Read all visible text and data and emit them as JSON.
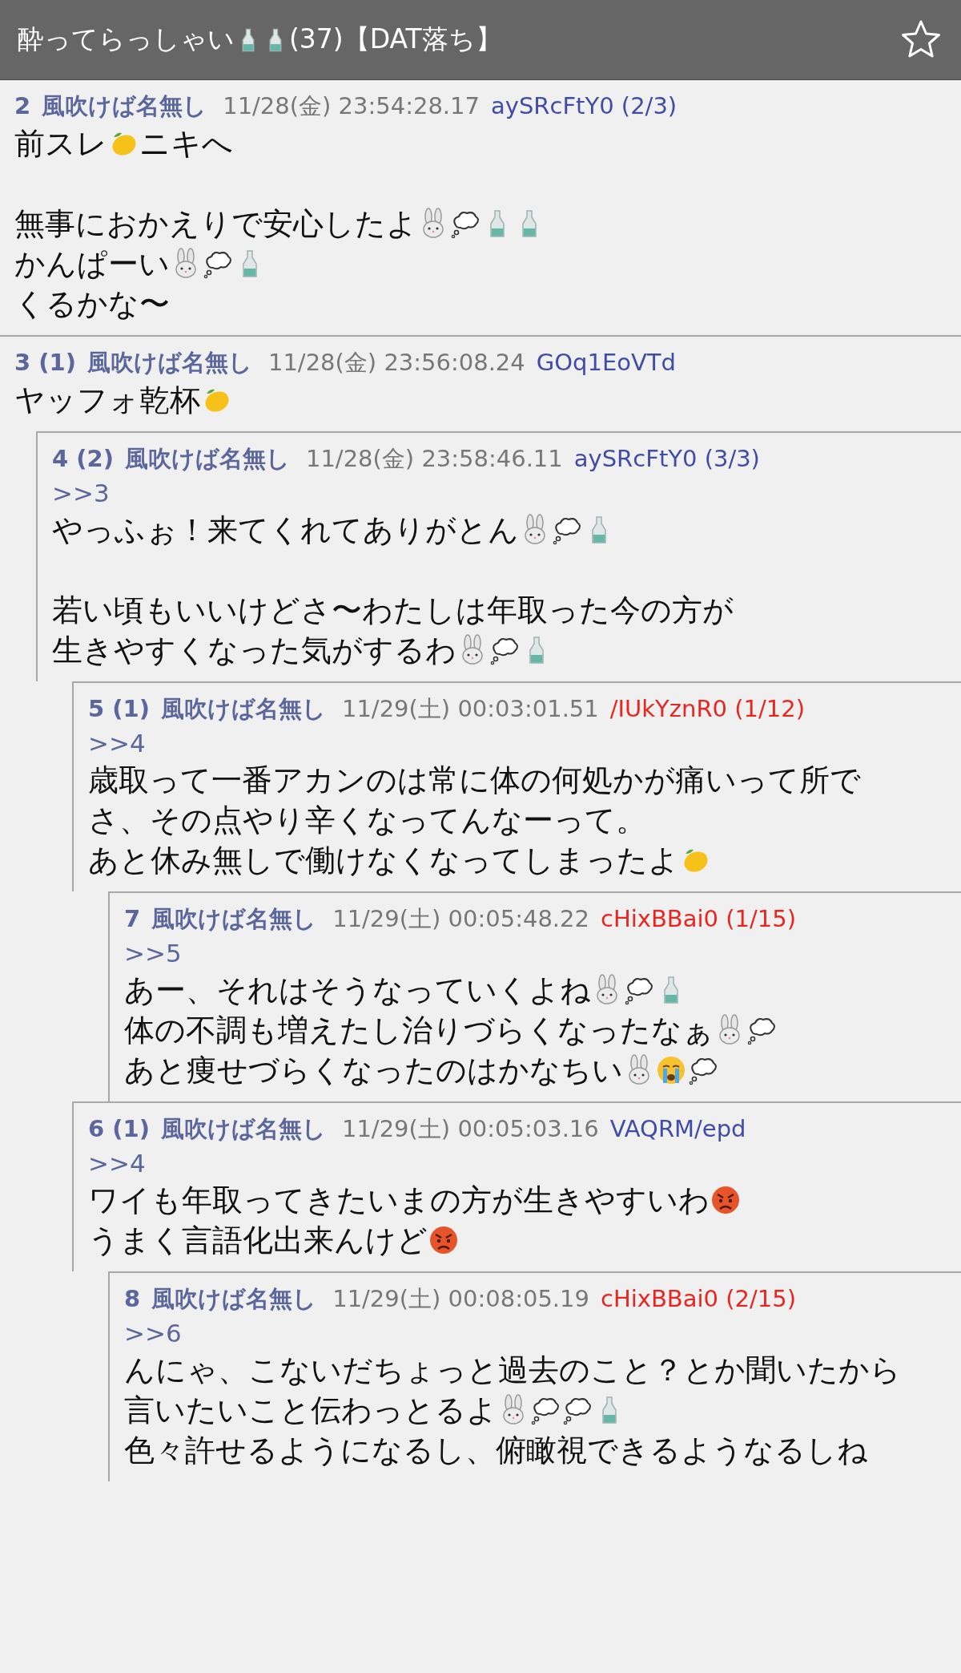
{
  "header": {
    "title": [
      {
        "kind": "text",
        "text": "酔ってらっしゃい"
      },
      {
        "kind": "sake"
      },
      {
        "kind": "sake"
      },
      {
        "kind": "text",
        "text": "(37)【DAT落ち】"
      }
    ],
    "favorite": false
  },
  "posts": [
    {
      "number": "2",
      "name": "風吹けば名無し",
      "date": "11/28(金) 23:54:28.17",
      "id": {
        "text": "aySRcFtY0 (2/3)",
        "color": "#3f4da8"
      },
      "paragraphs": [
        [
          [
            {
              "kind": "text",
              "text": "前スレ"
            },
            {
              "kind": "lemon"
            },
            {
              "kind": "text",
              "text": "ニキへ"
            }
          ]
        ],
        [
          [
            {
              "kind": "text",
              "text": "無事におかえりで安心したよ"
            },
            {
              "kind": "rabbit"
            },
            {
              "kind": "thought"
            },
            {
              "kind": "sake"
            },
            {
              "kind": "sake"
            }
          ],
          [
            {
              "kind": "text",
              "text": "かんぱーい"
            },
            {
              "kind": "rabbit"
            },
            {
              "kind": "thought"
            },
            {
              "kind": "sake"
            }
          ],
          [
            {
              "kind": "text",
              "text": "くるかな〜"
            }
          ]
        ]
      ]
    },
    {
      "number": "3 (1)",
      "name": "風吹けば名無し",
      "date": "11/28(金) 23:56:08.24",
      "id": {
        "text": "GOq1EoVTd",
        "color": "#3f4da8"
      },
      "paragraphs": [
        [
          [
            {
              "kind": "text",
              "text": "ヤッフォ乾杯"
            },
            {
              "kind": "lemon"
            }
          ]
        ]
      ],
      "children": [
        {
          "number": "4 (2)",
          "name": "風吹けば名無し",
          "date": "11/28(金) 23:58:46.11",
          "id": {
            "text": "aySRcFtY0 (3/3)",
            "color": "#3f4da8"
          },
          "anchor": ">>3",
          "paragraphs": [
            [
              [
                {
                  "kind": "text",
                  "text": "やっふぉ！来てくれてありがとん"
                },
                {
                  "kind": "rabbit"
                },
                {
                  "kind": "thought"
                },
                {
                  "kind": "sake"
                }
              ]
            ],
            [
              [
                {
                  "kind": "text",
                  "text": "若い頃もいいけどさ〜わたしは年取った今の方が"
                }
              ],
              [
                {
                  "kind": "text",
                  "text": "生きやすくなった気がするわ"
                },
                {
                  "kind": "rabbit"
                },
                {
                  "kind": "thought"
                },
                {
                  "kind": "sake"
                }
              ]
            ]
          ],
          "children": [
            {
              "number": "5 (1)",
              "name": "風吹けば名無し",
              "date": "11/29(土) 00:03:01.51",
              "id": {
                "text": "/IUkYznR0 (1/12)",
                "color": "#e8261f"
              },
              "anchor": ">>4",
              "paragraphs": [
                [
                  [
                    {
                      "kind": "text",
                      "text": "歳取って一番アカンのは常に体の何処かが痛いって所で"
                    }
                  ],
                  [
                    {
                      "kind": "text",
                      "text": "さ、その点やり辛くなってんなーって。"
                    }
                  ],
                  [
                    {
                      "kind": "text",
                      "text": "あと休み無しで働けなくなってしまったよ"
                    },
                    {
                      "kind": "lemon"
                    }
                  ]
                ]
              ],
              "children": [
                {
                  "number": "7",
                  "name": "風吹けば名無し",
                  "date": "11/29(土) 00:05:48.22",
                  "id": {
                    "text": "cHixBBai0 (1/15)",
                    "color": "#e8261f"
                  },
                  "anchor": ">>5",
                  "paragraphs": [
                    [
                      [
                        {
                          "kind": "text",
                          "text": "あー、それはそうなっていくよね"
                        },
                        {
                          "kind": "rabbit"
                        },
                        {
                          "kind": "thought"
                        },
                        {
                          "kind": "sake"
                        }
                      ],
                      [
                        {
                          "kind": "text",
                          "text": "体の不調も増えたし治りづらくなったなぁ"
                        },
                        {
                          "kind": "rabbit"
                        },
                        {
                          "kind": "thought"
                        }
                      ],
                      [
                        {
                          "kind": "text",
                          "text": "あと痩せづらくなったのはかなちい"
                        },
                        {
                          "kind": "rabbit"
                        },
                        {
                          "kind": "crying"
                        },
                        {
                          "kind": "thought"
                        }
                      ]
                    ]
                  ]
                }
              ]
            },
            {
              "number": "6 (1)",
              "name": "風吹けば名無し",
              "date": "11/29(土) 00:05:03.16",
              "id": {
                "text": "VAQRM/epd",
                "color": "#3f4da8"
              },
              "anchor": ">>4",
              "paragraphs": [
                [
                  [
                    {
                      "kind": "text",
                      "text": "ワイも年取ってきたいまの方が生きやすいわ"
                    },
                    {
                      "kind": "angry"
                    }
                  ],
                  [
                    {
                      "kind": "text",
                      "text": "うまく言語化出来んけど"
                    },
                    {
                      "kind": "angry"
                    }
                  ]
                ]
              ],
              "children": [
                {
                  "number": "8",
                  "name": "風吹けば名無し",
                  "date": "11/29(土) 00:08:05.19",
                  "id": {
                    "text": "cHixBBai0 (2/15)",
                    "color": "#e8261f"
                  },
                  "anchor": ">>6",
                  "paragraphs": [
                    [
                      [
                        {
                          "kind": "text",
                          "text": "んにゃ、こないだちょっと過去のこと？とか聞いたから"
                        }
                      ],
                      [
                        {
                          "kind": "text",
                          "text": "言いたいこと伝わっとるよ"
                        },
                        {
                          "kind": "rabbit"
                        },
                        {
                          "kind": "thought"
                        },
                        {
                          "kind": "thought"
                        },
                        {
                          "kind": "sake"
                        }
                      ],
                      [
                        {
                          "kind": "text",
                          "text": "色々許せるようになるし、俯瞰視できるようなるしね"
                        }
                      ]
                    ]
                  ]
                }
              ]
            }
          ]
        }
      ]
    }
  ]
}
